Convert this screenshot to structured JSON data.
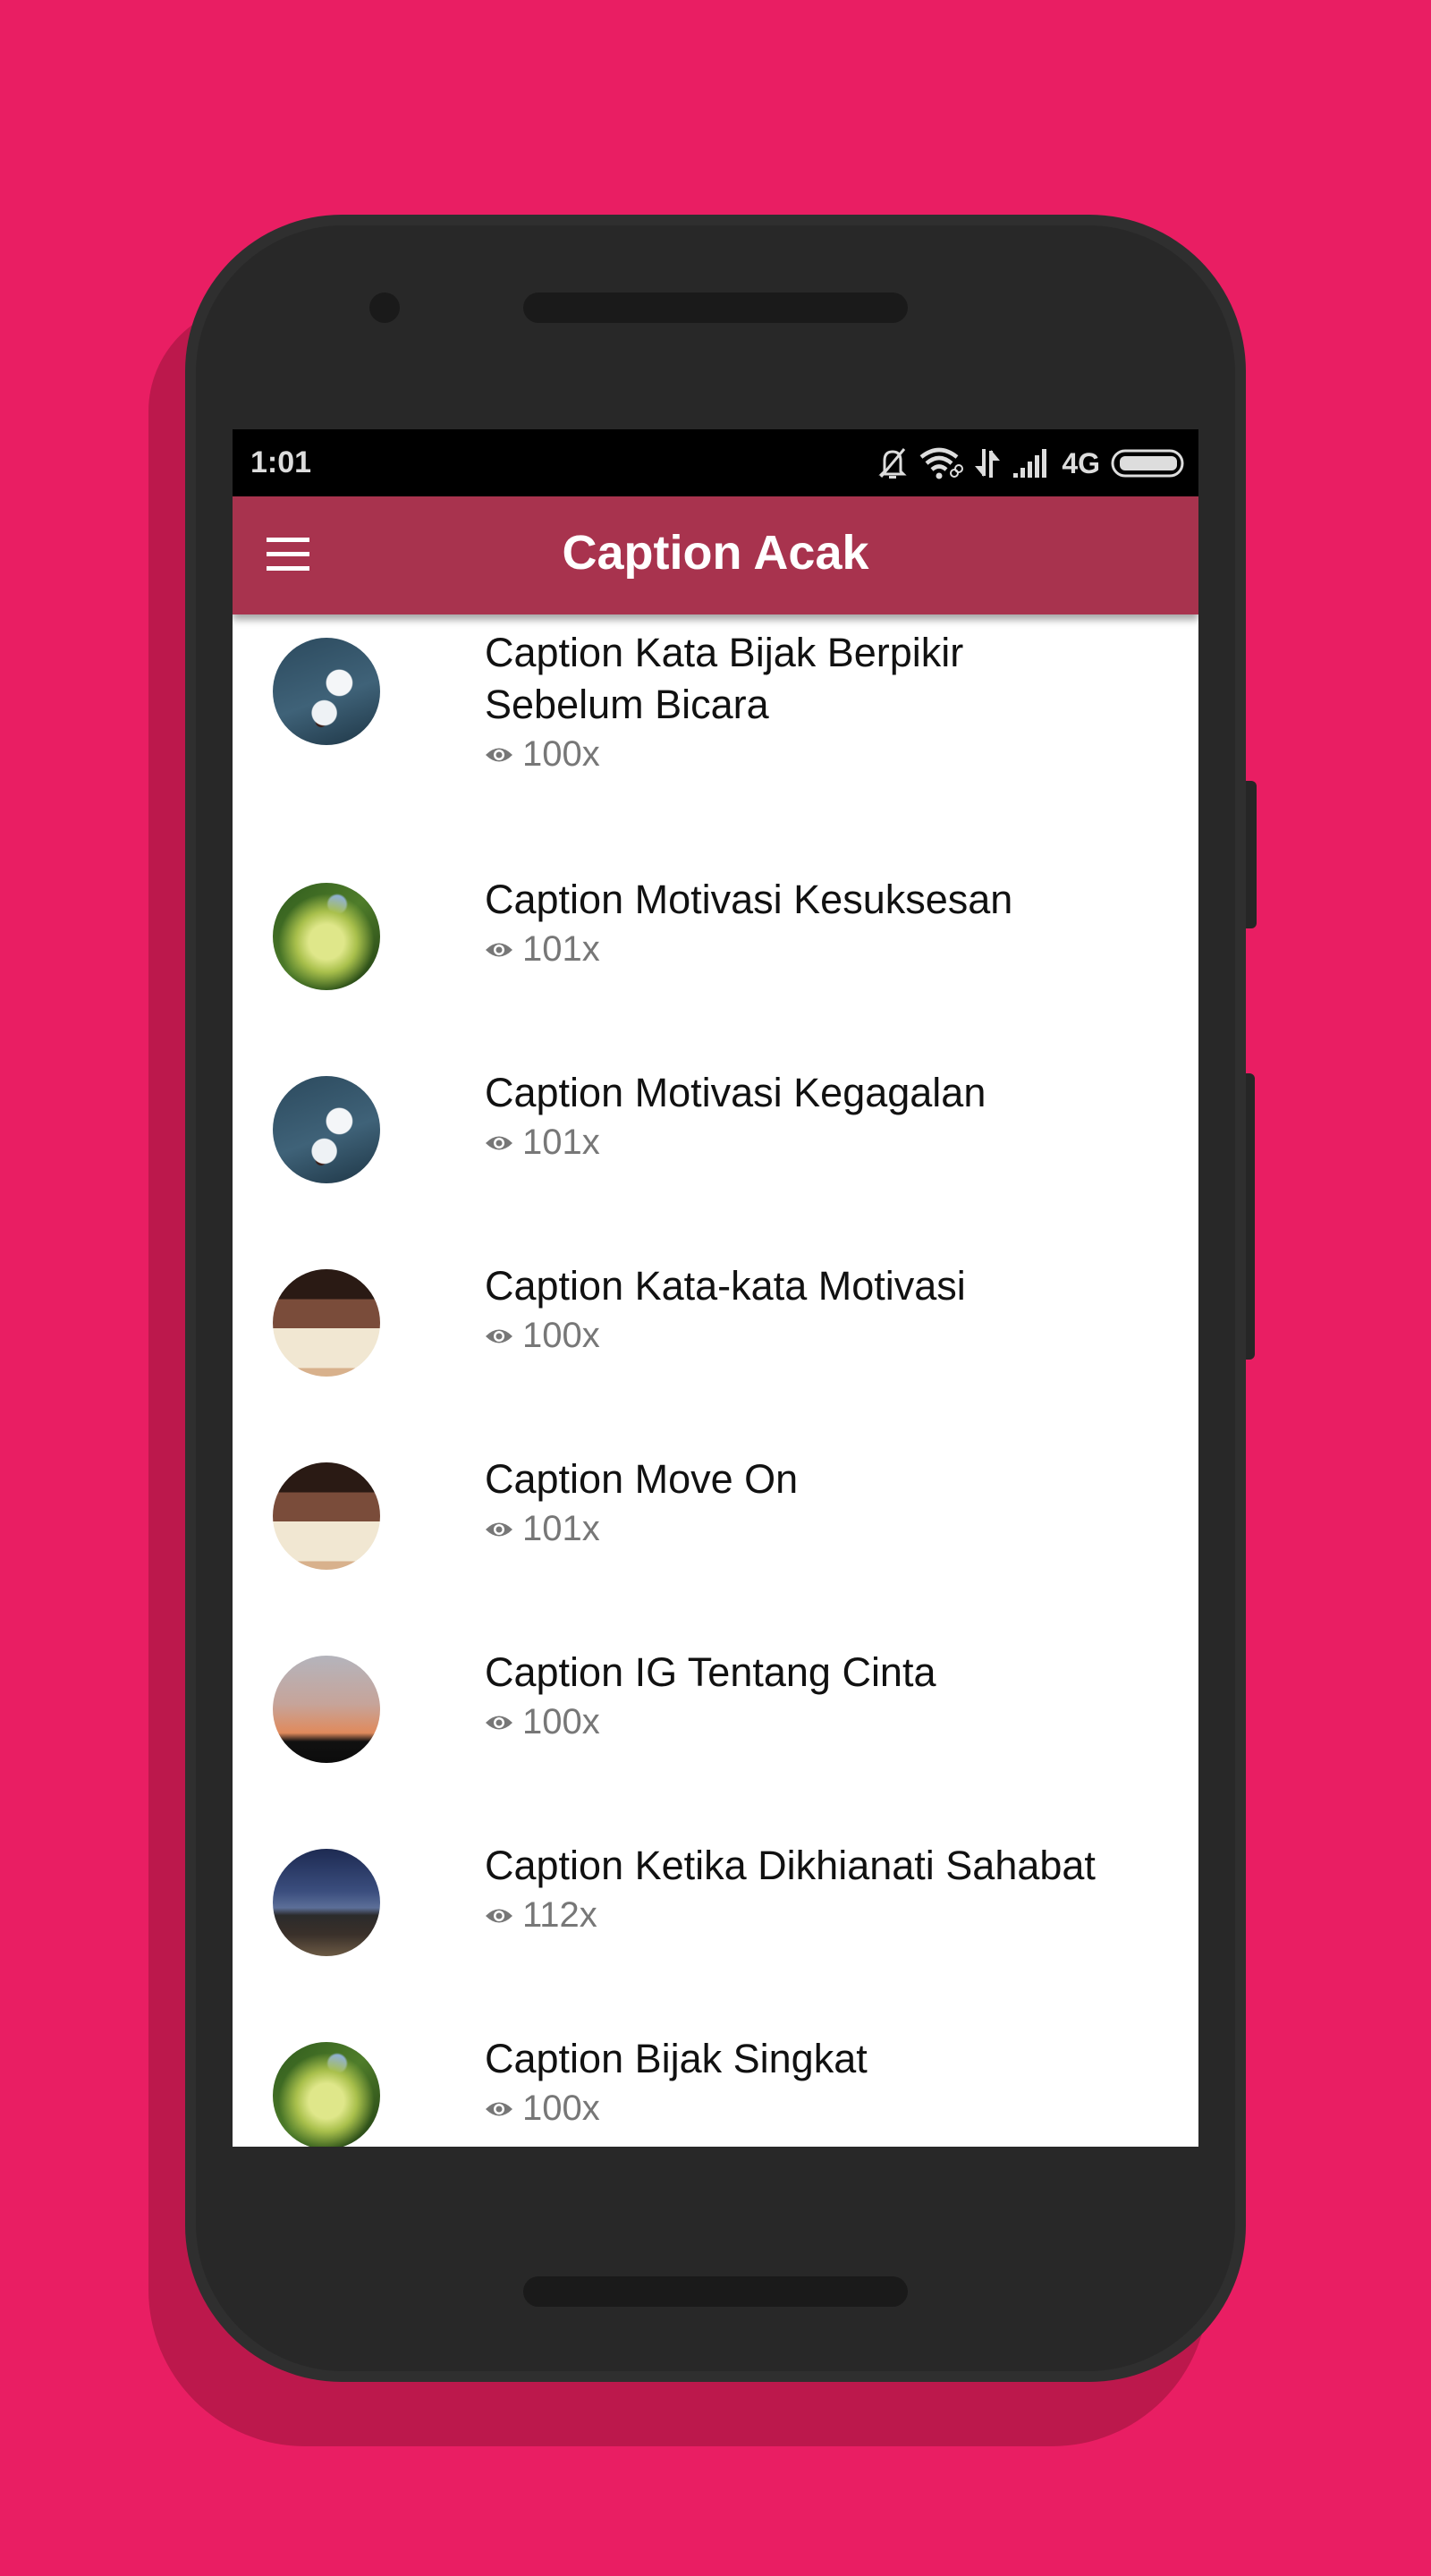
{
  "status_bar": {
    "time": "1:01",
    "network_label": "4G",
    "icons": [
      "notifications-off-icon",
      "wifi-icon",
      "data-transfer-icon",
      "signal-icon",
      "battery-icon"
    ]
  },
  "app_bar": {
    "title": "Caption Acak",
    "menu_icon": "hamburger-menu-icon"
  },
  "colors": {
    "background": "#E91E63",
    "app_bar": "#A8334E",
    "phone_body": "#282828"
  },
  "list": {
    "items": [
      {
        "title": "Caption Kata Bijak Berpikir Sebelum Bicara",
        "views": "100x",
        "thumbnail": "white-flower"
      },
      {
        "title": "Caption Motivasi Kesuksesan",
        "views": "101x",
        "thumbnail": "green-foliage"
      },
      {
        "title": "Caption Motivasi Kegagalan",
        "views": "101x",
        "thumbnail": "white-flower"
      },
      {
        "title": "Caption Kata-kata Motivasi",
        "views": "100x",
        "thumbnail": "girl-with-cup"
      },
      {
        "title": "Caption Move On",
        "views": "101x",
        "thumbnail": "girl-with-cup"
      },
      {
        "title": "Caption IG Tentang Cinta",
        "views": "100x",
        "thumbnail": "bicycle-sunset"
      },
      {
        "title": "Caption Ketika Dikhianati Sahabat",
        "views": "112x",
        "thumbnail": "friends-on-bench"
      },
      {
        "title": "Caption Bijak Singkat",
        "views": "100x",
        "thumbnail": "green-foliage"
      }
    ]
  }
}
